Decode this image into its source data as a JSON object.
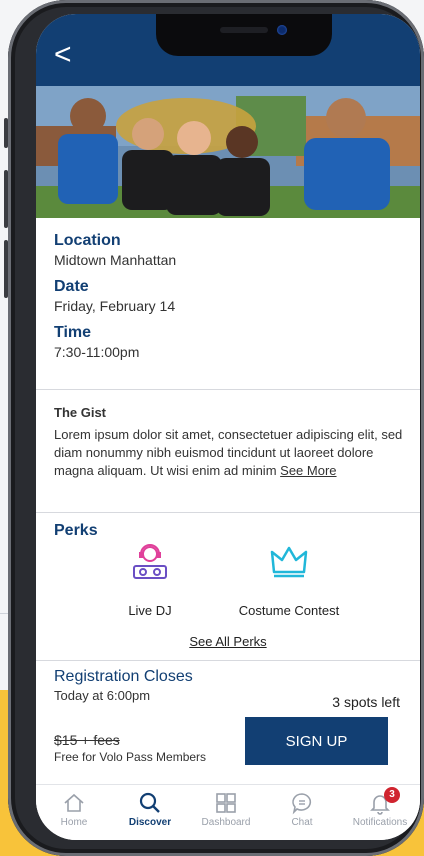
{
  "header": {
    "back_icon": "chevron-left-icon",
    "back_glyph": "<"
  },
  "event": {
    "location_label": "Location",
    "location_value": "Midtown Manhattan",
    "date_label": "Date",
    "date_value": "Friday, February 14",
    "time_label": "Time",
    "time_value": "7:30-11:00pm"
  },
  "gist": {
    "title": "The Gist",
    "body": "Lorem ipsum dolor sit amet, consectetuer adipiscing elit, sed diam nonummy nibh euismod tincidunt ut laoreet dolore magna aliquam. Ut wisi enim ad minim",
    "see_more": "See More"
  },
  "perks": {
    "title": "Perks",
    "items": [
      {
        "icon": "dj-icon",
        "label": "Live DJ",
        "color": "#e0409a"
      },
      {
        "icon": "crown-icon",
        "label": "Costume Contest",
        "color": "#21b7d9"
      }
    ],
    "see_all": "See All Perks"
  },
  "registration": {
    "title": "Registration Closes",
    "time": "Today at 6:00pm",
    "spots": "3 spots left",
    "price": "$15 + fees",
    "pass_note": "Free for Volo Pass Members",
    "signup_label": "SIGN UP"
  },
  "tabbar": {
    "items": [
      {
        "label": "Home",
        "icon": "home-icon"
      },
      {
        "label": "Discover",
        "icon": "search-icon"
      },
      {
        "label": "Dashboard",
        "icon": "grid-icon"
      },
      {
        "label": "Chat",
        "icon": "chat-icon"
      },
      {
        "label": "Notifications",
        "icon": "bell-icon",
        "badge": "3"
      }
    ]
  },
  "colors": {
    "brand": "#123f73",
    "badge": "#d0242f",
    "accent_yellow": "#f8c33a"
  }
}
